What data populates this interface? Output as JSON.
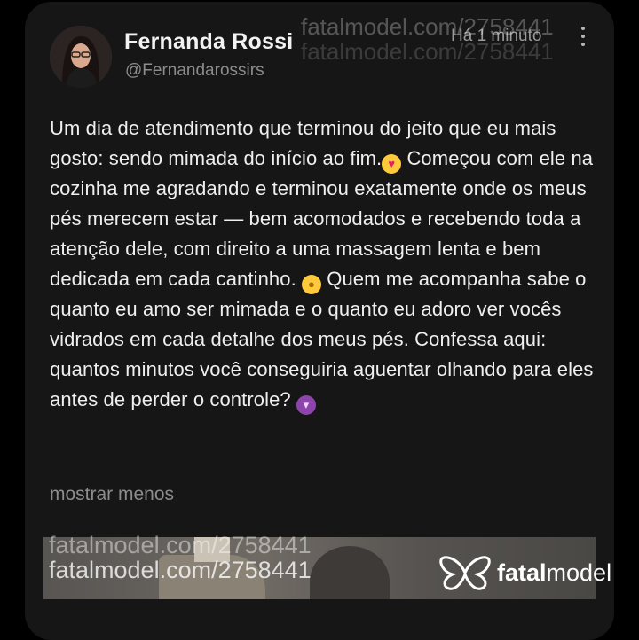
{
  "post": {
    "author_name": "Fernanda Rossi",
    "author_handle": "@Fernandarossirs",
    "time_ago": "Há 1 minuto",
    "body_segments": [
      "Um dia de atendimento que terminou do jeito que eu mais gosto: sendo mimada do início ao fim.",
      " Começou com ele na cozinha me agradando e terminou exatamente onde os meus pés merecem estar — bem acomodados e recebendo toda a atenção dele, com direito a uma massagem lenta e bem dedicada em cada cantinho. ",
      " Quem me acompanha sabe o quanto eu amo ser mimada e o quanto eu adoro ver vocês vidrados em cada detalhe dos meus pés. Confessa aqui: quantos minutos você conseguiria aguentar olhando para eles antes de perder o controle? "
    ],
    "emojis": {
      "heart_eyes": "heart-eyes-emoji",
      "shushing": "shushing-face-emoji",
      "devil": "smiling-devil-emoji"
    },
    "toggle_label": "mostrar menos"
  },
  "watermark": {
    "text": "fatalmodel.com/2758441"
  },
  "brand": {
    "logo_light": "fatal",
    "logo_bold": "model"
  },
  "colors": {
    "card_bg": "#161616",
    "page_bg": "#000000",
    "text_primary": "#efefef",
    "text_secondary": "#8c8c8c"
  }
}
